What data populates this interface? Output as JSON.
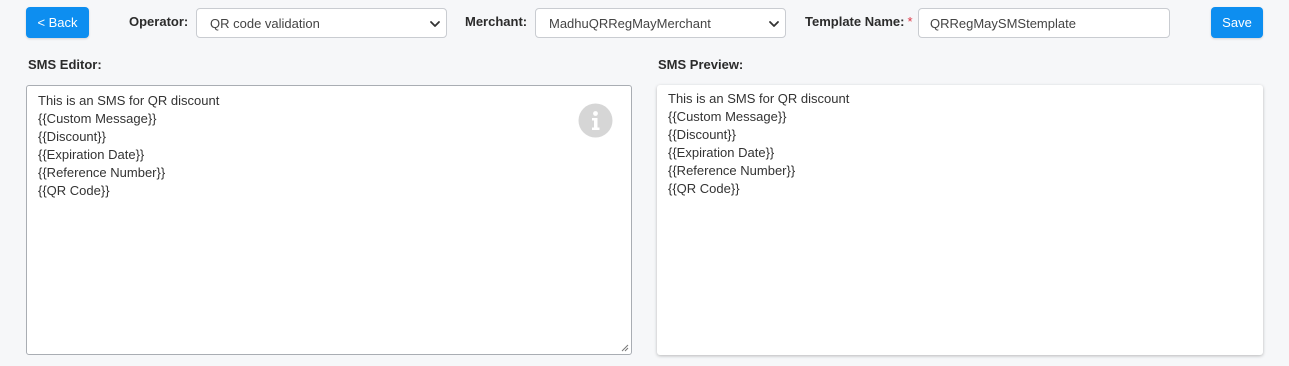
{
  "header": {
    "back_label": "< Back",
    "save_label": "Save",
    "operator": {
      "label": "Operator:",
      "value": "QR code validation"
    },
    "merchant": {
      "label": "Merchant:",
      "value": "MadhuQRRegMayMerchant"
    },
    "template_name": {
      "label": "Template Name:",
      "required_mark": "*",
      "value": "QRRegMaySMStemplate"
    }
  },
  "editor": {
    "label": "SMS Editor:",
    "lines": [
      "This is an SMS for QR discount",
      "{{Custom Message}}",
      "{{Discount}}",
      "{{Expiration Date}}",
      "{{Reference Number}}",
      "{{QR Code}}"
    ],
    "info_icon": "info-circle-icon"
  },
  "preview": {
    "label": "SMS Preview:",
    "lines": [
      "This is an SMS for QR discount",
      "{{Custom Message}}",
      "{{Discount}}",
      "{{Expiration Date}}",
      "{{Reference Number}}",
      "{{QR Code}}"
    ]
  },
  "colors": {
    "primary": "#0d8ef0",
    "background": "#f6f7f9",
    "required": "#dc3545",
    "info_icon": "#d6d6d6"
  }
}
